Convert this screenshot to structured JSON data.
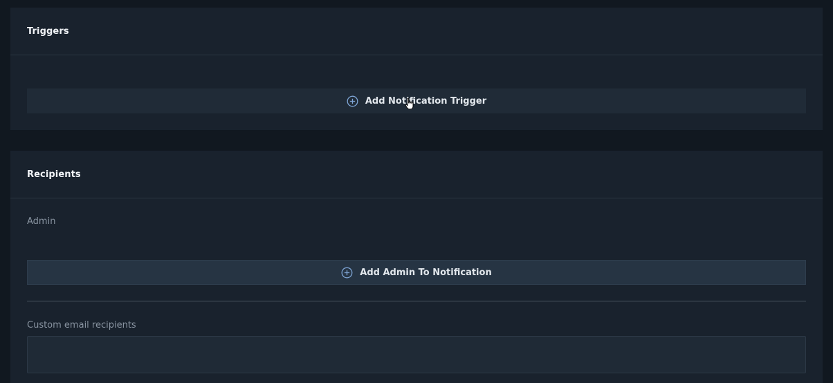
{
  "triggers": {
    "title": "Triggers",
    "add_button_label": "Add Notification Trigger",
    "add_button_icon": "plus-circle-icon"
  },
  "recipients": {
    "title": "Recipients",
    "admin_label": "Admin",
    "add_admin_button_label": "Add Admin To Notification",
    "add_admin_button_icon": "plus-circle-icon",
    "custom_email_label": "Custom email recipients",
    "custom_email_value": ""
  },
  "colors": {
    "background": "#111820",
    "panel": "#19222d",
    "accent_icon": "#7fa6d6",
    "button_text": "#e2e7ec"
  }
}
